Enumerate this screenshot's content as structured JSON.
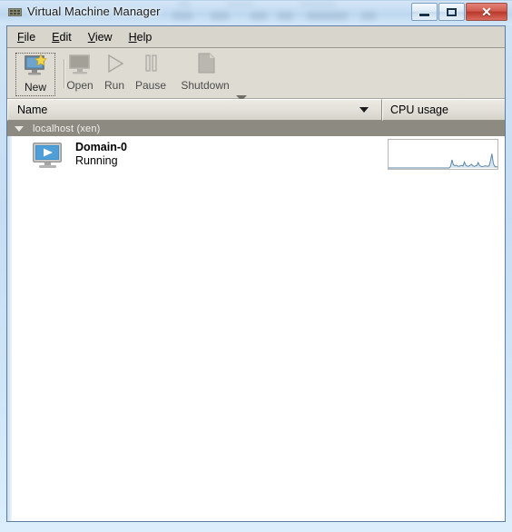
{
  "window": {
    "title": "Virtual Machine Manager",
    "title_icon": "vmm-app-icon",
    "caption": {
      "minimize_label": "Minimize",
      "maximize_label": "Maximize",
      "close_label": "✕"
    }
  },
  "menubar": {
    "items": [
      {
        "label": "File",
        "mnemonic": "F"
      },
      {
        "label": "Edit",
        "mnemonic": "E"
      },
      {
        "label": "View",
        "mnemonic": "V"
      },
      {
        "label": "Help",
        "mnemonic": "H"
      }
    ]
  },
  "toolbar": {
    "buttons": [
      {
        "label": "New",
        "icon": "new-vm-icon",
        "enabled": true,
        "focused": true
      },
      {
        "label": "Open",
        "icon": "monitor-icon",
        "enabled": false,
        "focused": false
      },
      {
        "label": "Run",
        "icon": "play-icon",
        "enabled": false,
        "focused": false
      },
      {
        "label": "Pause",
        "icon": "pause-icon",
        "enabled": false,
        "focused": false
      },
      {
        "label": "Shutdown",
        "icon": "shutdown-icon",
        "enabled": false,
        "focused": false
      }
    ],
    "overflow_icon": "chevron-down-icon"
  },
  "columns": {
    "name": "Name",
    "cpu": "CPU usage",
    "sort_icon": "sort-descending-arrow"
  },
  "list": {
    "group": {
      "label": "localhost (xen)",
      "expander_icon": "triangle-down-icon",
      "expanded": true
    },
    "rows": [
      {
        "name": "Domain-0",
        "state": "Running",
        "icon": "running-vm-icon",
        "cpu_sparkline": [
          0,
          0,
          0,
          0,
          0,
          0,
          0,
          0,
          0,
          0,
          0,
          0,
          0,
          0,
          0,
          0,
          0,
          0,
          0,
          0,
          0,
          0,
          0,
          0,
          0,
          0,
          0,
          0,
          0,
          0,
          0,
          0,
          0,
          0,
          0,
          0,
          0,
          0,
          0,
          0,
          0,
          0,
          0,
          0,
          0,
          6,
          30,
          12,
          8,
          10,
          7,
          6,
          8,
          9,
          7,
          22,
          10,
          7,
          6,
          9,
          14,
          8,
          6,
          7,
          9,
          20,
          9,
          6,
          5,
          6,
          8,
          7,
          6,
          8,
          28,
          52,
          16,
          6,
          4,
          4
        ]
      }
    ]
  },
  "colors": {
    "title_text": "#1a1a1a",
    "frame_glass": "#c6ddf3",
    "toolbar_bg": "#dedbd3",
    "group_row_bg": "#8d8a81",
    "close_button": "#b8392c",
    "sparkline_line": "#5b87a8",
    "sparkline_fill": "#dbe7f0",
    "vm_icon_blue": "#2f7fc4"
  }
}
